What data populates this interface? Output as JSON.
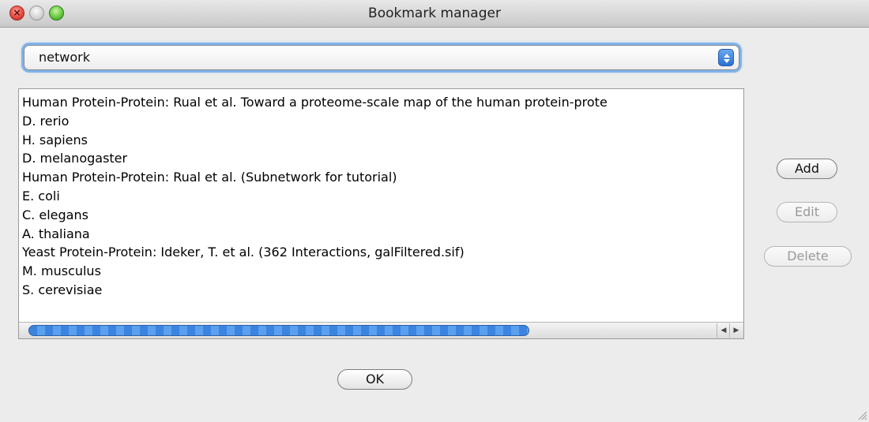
{
  "window": {
    "title": "Bookmark manager"
  },
  "category_select": {
    "selected": "network"
  },
  "bookmarks": [
    "Human Protein-Protein: Rual et al. Toward a proteome-scale map of the human protein-prote",
    "D. rerio",
    "H. sapiens",
    "D. melanogaster",
    "Human Protein-Protein: Rual et al. (Subnetwork for tutorial)",
    "E. coli",
    "C. elegans",
    "A. thaliana",
    "Yeast Protein-Protein: Ideker, T. et al. (362 Interactions, galFiltered.sif)",
    "M. musculus",
    "S. cerevisiae"
  ],
  "buttons": {
    "add": "Add",
    "edit": "Edit",
    "delete": "Delete",
    "ok": "OK"
  },
  "scrollbar": {
    "horizontal_position": 0
  },
  "colors": {
    "focus_ring": "#7fb3ec",
    "scroll_thumb": "#3b84df"
  }
}
